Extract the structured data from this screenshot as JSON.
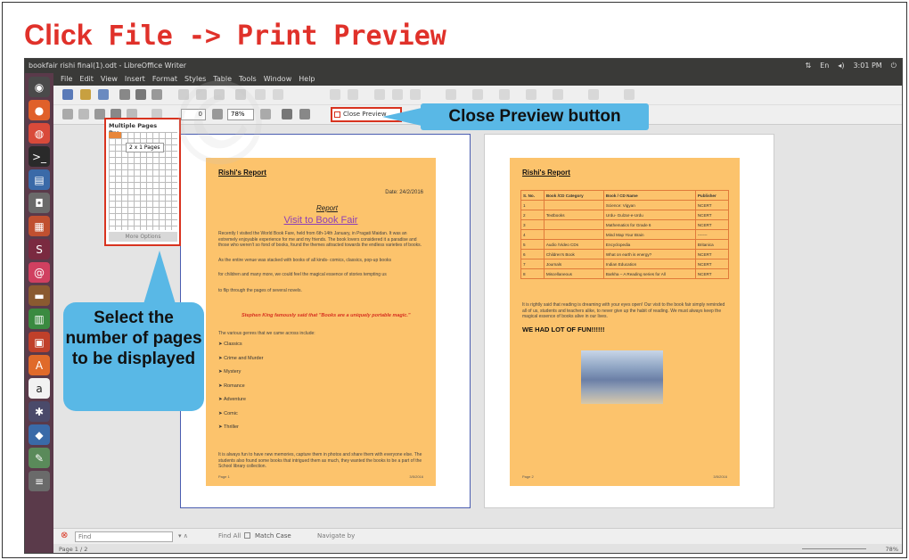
{
  "heading": {
    "word1": "Click",
    "rest": "File -> Print Preview"
  },
  "window": {
    "title": "bookfair rishi final(1).odt - LibreOffice Writer",
    "clock": "3:01 PM",
    "top_right_en": "En"
  },
  "menu": [
    "File",
    "Edit",
    "View",
    "Insert",
    "Format",
    "Styles",
    "Table",
    "Tools",
    "Window",
    "Help"
  ],
  "preview_toolbar": {
    "page_number": "0",
    "zoom": "78%",
    "close_preview_label": "Close Preview"
  },
  "multiple_pages_popup": {
    "title": "Multiple Pages Pre...",
    "selection_label": "2 x 1 Pages",
    "more_options": "More Options"
  },
  "page1": {
    "title": "Rishi's Report",
    "date": "Date: 24/2/2016",
    "report": "Report",
    "heading": "Visit to Book Fair",
    "para1": "Recently I visited the World Book Fare, held from 6th-14th January, in Pragati Maidan. It was an extremely enjoyable experience for me and my friends. The book lovers considered it a paradise and those who weren't so fond of books, found the themes attracted towards the endless varieties of books.",
    "para2": "As the entire venue was stacked with books of all kinds- comics, classics, pop-up books",
    "para3": "for children and many more, we could feel the magical essence of stories tempting us",
    "para4": "to flip through the pages of several novels.",
    "quote": "Stephen King famously said that \"Books are a uniquely portable magic.\"",
    "genres_intro": "The various genres that we came across include:",
    "genres": [
      "Classics",
      "Crime and Murder",
      "Mystery",
      "Romance",
      "Adventure",
      "Comic",
      "Thriller"
    ],
    "closing": "It is always fun to have new memories, capture them in photos and share them with everyone else. The students also found some books that intrigued them as much, they wanted the books to be a part of the School library collection.",
    "footer_left": "Page 1",
    "footer_right": "3/5/2016"
  },
  "page2": {
    "title": "Rishi's Report",
    "table_headers": [
      "S. No.",
      "Book /CD Category",
      "Book / CD Name",
      "Publisher"
    ],
    "table_rows": [
      [
        "1",
        "",
        "Science: Vigyan",
        "NCERT"
      ],
      [
        "2",
        "Textbooks",
        "Urdu- Gulzar-e-Urdu",
        "NCERT"
      ],
      [
        "3",
        "",
        "Mathematics for Grade 6",
        "NCERT"
      ],
      [
        "4",
        "",
        "Mind Map Your Brain",
        "-------"
      ],
      [
        "5",
        "Audio /Video CDs",
        "Encyclopedia",
        "Britanica"
      ],
      [
        "6",
        "Children's Book",
        "What on earth is energy?",
        "NCERT"
      ],
      [
        "7",
        "Journals",
        "Indian Education",
        "NCERT"
      ],
      [
        "8",
        "Miscellaneous",
        "Barkha – A Reading series for All",
        "NCERT"
      ]
    ],
    "para": "It is rightly said that reading is dreaming with your eyes open! Our visit to the book fair simply reminded all of us, students and teachers alike, to never give up the habit of reading. We must always keep the magical essence of books alive in our lives.",
    "fun": "WE HAD LOT OF FUN!!!!!!",
    "footer_left": "Page 2",
    "footer_right": "3/5/2016"
  },
  "findbar": {
    "placeholder": "Find",
    "find_all": "Find All",
    "match_case": "Match Case",
    "navigate_by": "Navigate by"
  },
  "statusbar": {
    "page": "Page 1 / 2",
    "zoom": "78%"
  },
  "callouts": {
    "close_preview": "Close Preview button",
    "select_pages": "Select the number of pages to be displayed"
  },
  "colors": {
    "heading_red": "#e0312a",
    "callout_blue": "#59b8e6",
    "sheet_orange": "#fcc36c",
    "highlight_red": "#d8331f"
  }
}
